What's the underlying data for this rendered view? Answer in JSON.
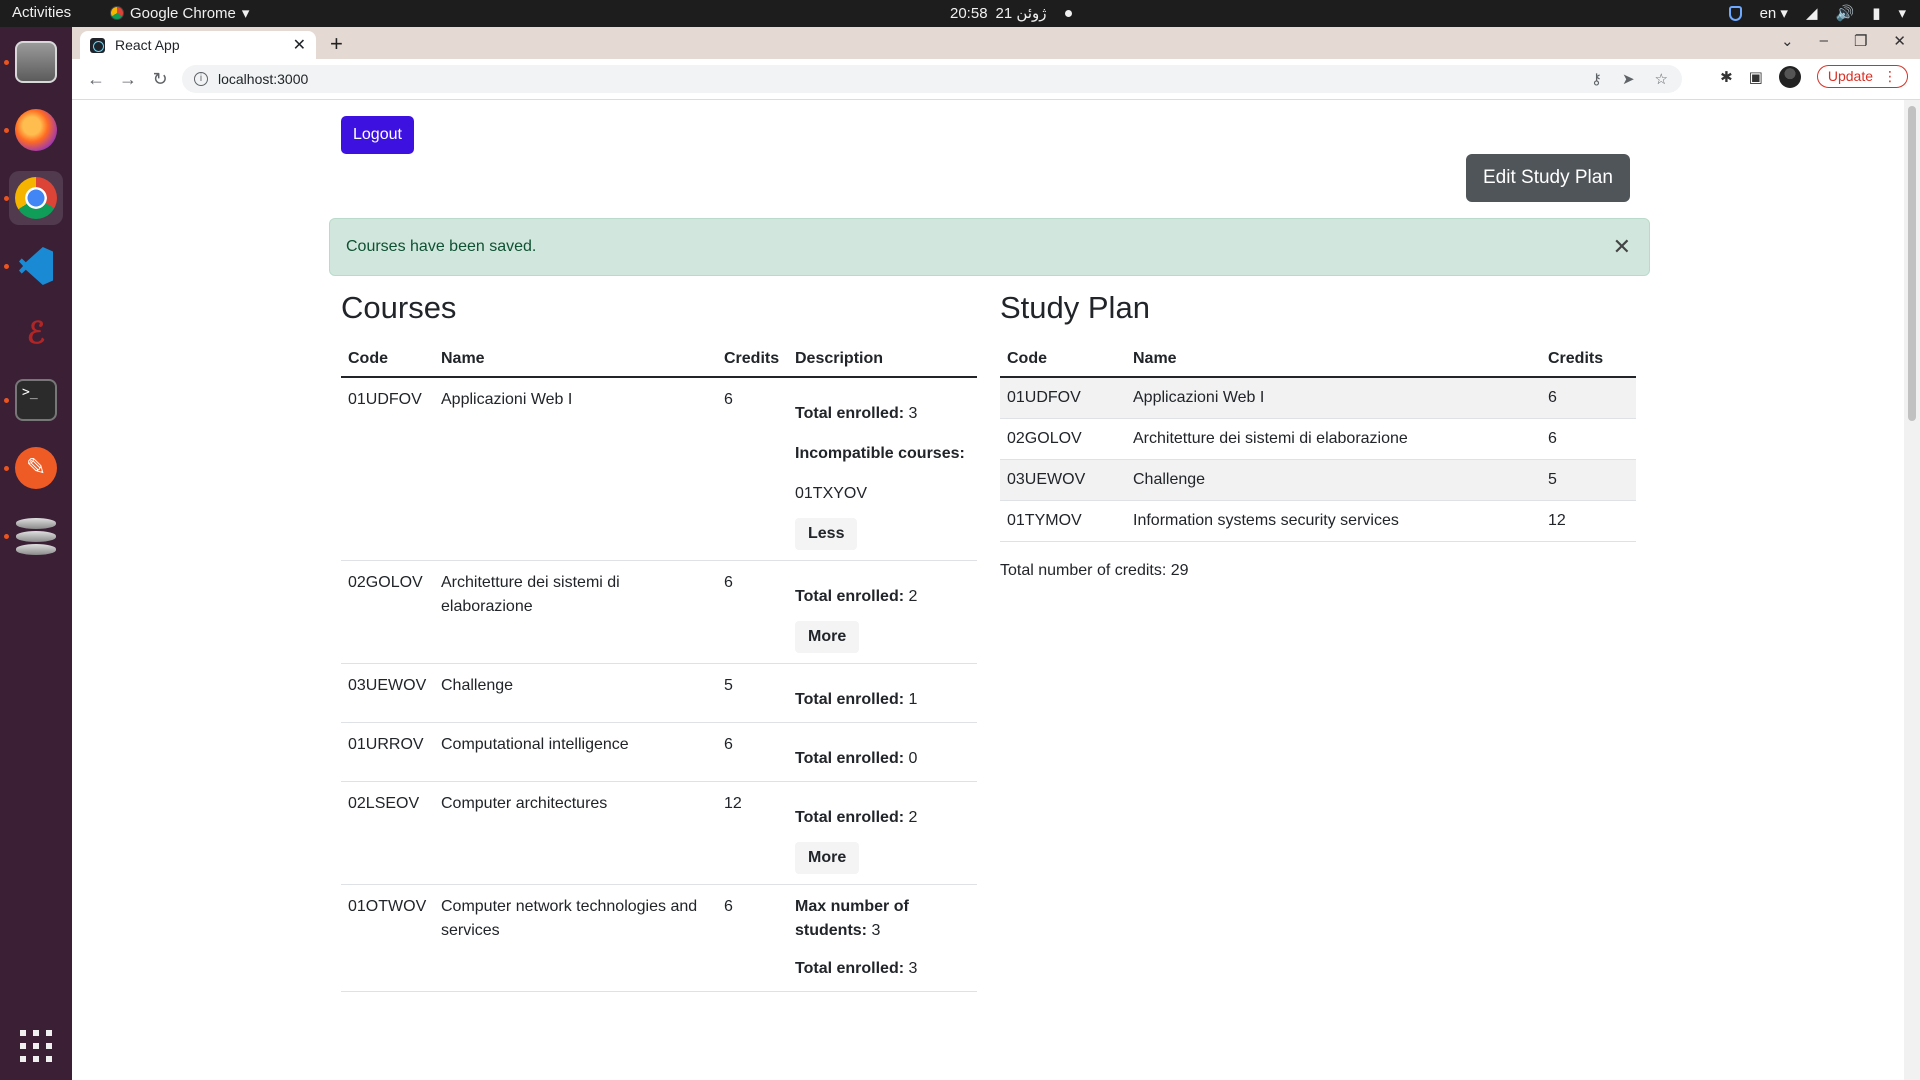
{
  "topbar": {
    "activities": "Activities",
    "app_name": "Google Chrome",
    "time": "20:58",
    "date": "21 ژوئن",
    "lang": "en"
  },
  "browser": {
    "tab_title": "React App",
    "url": "localhost:3000",
    "update_label": "Update"
  },
  "page": {
    "logout_label": "Logout",
    "edit_label": "Edit Study Plan",
    "alert_text": "Courses have been saved.",
    "courses_title": "Courses",
    "plan_title": "Study Plan",
    "courses_headers": [
      "Code",
      "Name",
      "Credits",
      "Description"
    ],
    "plan_headers": [
      "Code",
      "Name",
      "Credits"
    ],
    "courses": [
      {
        "code": "01UDFOV",
        "name": "Applicazioni Web I",
        "credits": "6",
        "enrolled_label": "Total enrolled:",
        "enrolled": "3",
        "incompatible_label": "Incompatible courses:",
        "incompatible": "01TXYOV",
        "toggle": "Less"
      },
      {
        "code": "02GOLOV",
        "name": "Architetture dei sistemi di elaborazione",
        "credits": "6",
        "enrolled_label": "Total enrolled:",
        "enrolled": "2",
        "toggle": "More"
      },
      {
        "code": "03UEWOV",
        "name": "Challenge",
        "credits": "5",
        "enrolled_label": "Total enrolled:",
        "enrolled": "1"
      },
      {
        "code": "01URROV",
        "name": "Computational intelligence",
        "credits": "6",
        "enrolled_label": "Total enrolled:",
        "enrolled": "0"
      },
      {
        "code": "02LSEOV",
        "name": "Computer architectures",
        "credits": "12",
        "enrolled_label": "Total enrolled:",
        "enrolled": "2",
        "toggle": "More"
      },
      {
        "code": "01OTWOV",
        "name": "Computer network technologies and services",
        "credits": "6",
        "max_label": "Max number of students:",
        "max": "3",
        "enrolled_label": "Total enrolled:",
        "enrolled": "3"
      }
    ],
    "plan": [
      {
        "code": "01UDFOV",
        "name": "Applicazioni Web I",
        "credits": "6"
      },
      {
        "code": "02GOLOV",
        "name": "Architetture dei sistemi di elaborazione",
        "credits": "6"
      },
      {
        "code": "03UEWOV",
        "name": "Challenge",
        "credits": "5"
      },
      {
        "code": "01TYMOV",
        "name": "Information systems security services",
        "credits": "12"
      }
    ],
    "total_credits_text": "Total number of credits: 29"
  }
}
